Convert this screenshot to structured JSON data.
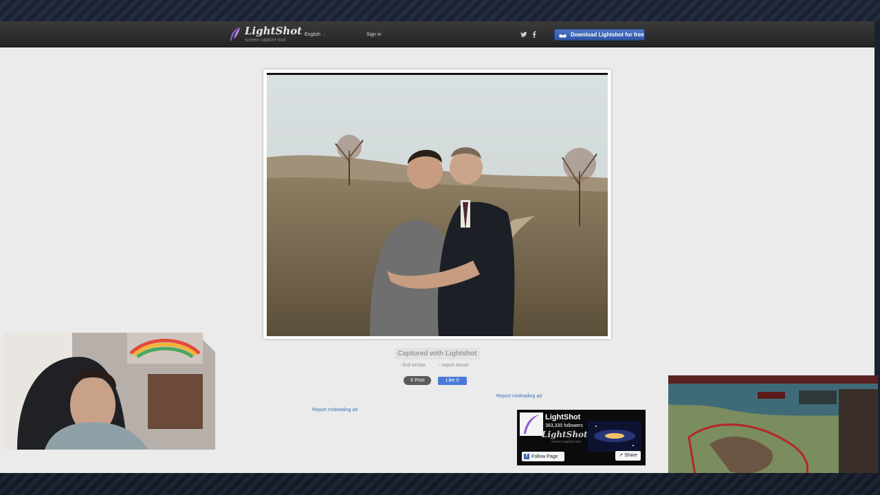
{
  "header": {
    "brand": "LightShot",
    "tagline": "screen capture tool",
    "language": "English",
    "signin": "Sign in",
    "download_label": "Download Lightshot for free"
  },
  "main": {
    "captured_label": "Captured with Lightshot",
    "find_similar": "find similar",
    "report_abuse": "report abuse",
    "x_post": "X Post",
    "fb_like": "Like 0",
    "report_ad_1": "Report misleading ad",
    "report_ad_2": "Report misleading ad"
  },
  "fb_widget": {
    "page_name": "LightShot",
    "followers": "383,335 followers",
    "watermark": "LightShot",
    "watermark_sub": "screen capture tool",
    "follow_label": "Follow Page",
    "share_label": "Share"
  },
  "icons": {
    "twitter": "twitter-icon",
    "facebook": "facebook-icon",
    "download": "cloud-download-icon",
    "feather": "feather-icon"
  },
  "colors": {
    "page_bg": "#ebebeb",
    "header": "#2d2d2d",
    "download_btn": "#3b63b3",
    "link": "#3f6fb3",
    "fb_blue": "#4267b2"
  }
}
